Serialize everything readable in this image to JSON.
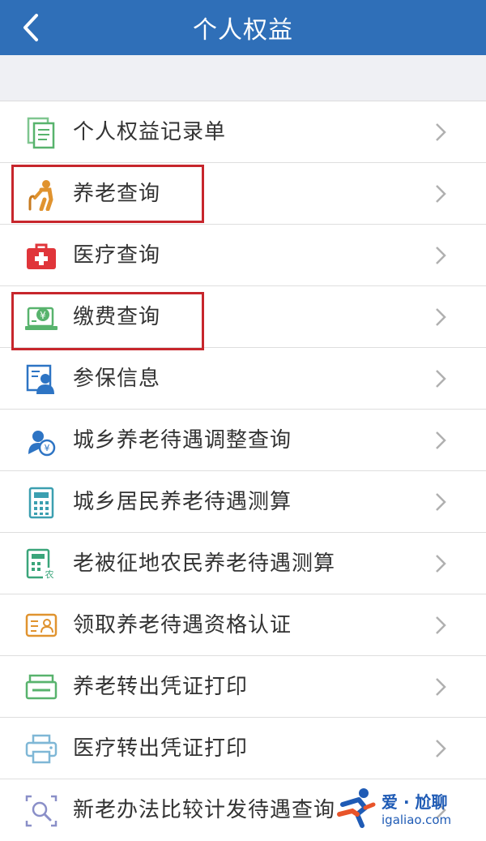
{
  "header": {
    "title": "个人权益"
  },
  "items": [
    {
      "label": "个人权益记录单",
      "icon": "document-list-icon"
    },
    {
      "label": "养老查询",
      "icon": "elderly-person-icon"
    },
    {
      "label": "医疗查询",
      "icon": "medical-kit-icon"
    },
    {
      "label": "缴费查询",
      "icon": "payment-yen-icon"
    },
    {
      "label": "参保信息",
      "icon": "insured-person-icon"
    },
    {
      "label": "城乡养老待遇调整查询",
      "icon": "pension-adjust-icon"
    },
    {
      "label": "城乡居民养老待遇测算",
      "icon": "calculator-icon"
    },
    {
      "label": "老被征地农民养老待遇测算",
      "icon": "farmer-calculator-icon"
    },
    {
      "label": "领取养老待遇资格认证",
      "icon": "id-card-icon"
    },
    {
      "label": "养老转出凭证打印",
      "icon": "pension-print-icon"
    },
    {
      "label": "医疗转出凭证打印",
      "icon": "printer-icon"
    },
    {
      "label": "新老办法比较计发待遇查询",
      "icon": "compare-search-icon"
    }
  ],
  "watermark": {
    "title": "爱 · 尬聊",
    "url": "igaliao.com"
  },
  "colors": {
    "header": "#2f6fb8",
    "highlight": "#c7262c",
    "icon_green": "#58b36d",
    "icon_orange": "#e0932f",
    "icon_red": "#e0353a",
    "icon_blue": "#2d74c4"
  }
}
